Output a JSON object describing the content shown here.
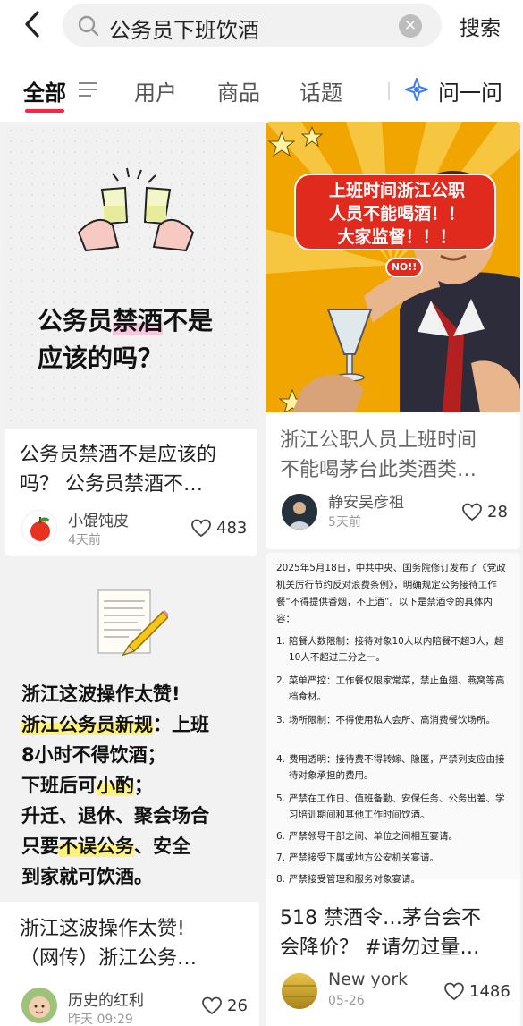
{
  "search": {
    "query": "公务员下班饮酒",
    "button_label": "搜索"
  },
  "tabs": {
    "all": "全部",
    "users": "用户",
    "products": "商品",
    "topics": "话题",
    "ask": "问一问"
  },
  "colors": {
    "accent": "#ff2442",
    "ask_icon": "#3b7cf6",
    "highlight_pink": "#f6c6dc",
    "highlight_yellow": "#fff27a"
  },
  "cards": [
    {
      "image_text": {
        "prefix": "公务员",
        "highlight": "禁酒",
        "suffix": "不是",
        "line2": "应该的吗？"
      },
      "title_lines": [
        "公务员禁酒不是应该的",
        "吗？ 公务员禁酒不…"
      ],
      "author": "小馄饨皮",
      "time": "4天前",
      "likes": "483",
      "avatar_icon": "apple-icon"
    },
    {
      "image_text": [
        "上班时间浙江公职",
        "人员不能喝酒！！",
        "大家监督！！！"
      ],
      "no_badge": "NO!!",
      "title_lines": [
        "浙江公职人员上班时间",
        "不能喝茅台此类酒类…"
      ],
      "author": "静安吴彦祖",
      "time": "5天前",
      "likes": "28"
    },
    {
      "post_lines": [
        {
          "parts": [
            {
              "text": "浙江这波操作太赞!",
              "hl": false
            }
          ]
        },
        {
          "parts": [
            {
              "text": "浙江公务员新规",
              "hl": true
            },
            {
              "text": "：上班",
              "hl": false
            }
          ]
        },
        {
          "parts": [
            {
              "text": "8小时不得饮酒；",
              "hl": false
            }
          ]
        },
        {
          "parts": [
            {
              "text": "下班后可",
              "hl": false
            },
            {
              "text": "小酌",
              "hl": true
            },
            {
              "text": "；",
              "hl": false
            }
          ]
        },
        {
          "parts": [
            {
              "text": "升迁、退休、聚会场合",
              "hl": false
            }
          ]
        },
        {
          "parts": [
            {
              "text": "只要",
              "hl": false
            },
            {
              "text": "不误公务",
              "hl": true
            },
            {
              "text": "、安全",
              "hl": false
            }
          ]
        },
        {
          "parts": [
            {
              "text": "到家就可饮酒。",
              "hl": false
            }
          ]
        }
      ],
      "title_lines": [
        "浙江这波操作太赞!",
        "（网传）浙江公务…"
      ],
      "author": "历史的红利",
      "time": "昨天 09:29",
      "likes": "26"
    },
    {
      "doc_intro": "2025年5月18日，中共中央、国务院修订发布了《党政机关厉行节约反对浪费条例》，明确规定公务接待工作餐“不得提供香烟，不上酒”。以下是禁酒令的具体内容：",
      "doc_items": [
        {
          "num": "1.",
          "text": "陪餐人数限制：接待对象10人以内陪餐不超3人，超10人不超过三分之一。"
        },
        {
          "num": "2.",
          "text": "菜单严控：工作餐仅限家常菜，禁止鱼翅、燕窝等高档食材。"
        },
        {
          "num": "3.",
          "text": "场所限制：不得使用私人会所、高消费餐饮场所。"
        },
        {
          "num": "4.",
          "text": "费用透明：接待费不得转嫁、隐匿，严禁列支应由接待对象承担的费用。"
        },
        {
          "num": "5.",
          "text": "严禁在工作日、值班备勤、安保任务、公务出差、学习培训期间和其他工作时间饮酒。"
        },
        {
          "num": "6.",
          "text": "严禁领导干部之间、单位之间相互宴请。"
        },
        {
          "num": "7.",
          "text": "严禁接受下属或地方公安机关宴请。"
        },
        {
          "num": "8.",
          "text": "严禁接受管理和服务对象宴请。"
        }
      ],
      "title_lines": [
        "518 禁酒令…茅台会不",
        "会降价？ #请勿过量…"
      ],
      "author": "New york",
      "time": "05-26",
      "likes": "1486"
    }
  ]
}
